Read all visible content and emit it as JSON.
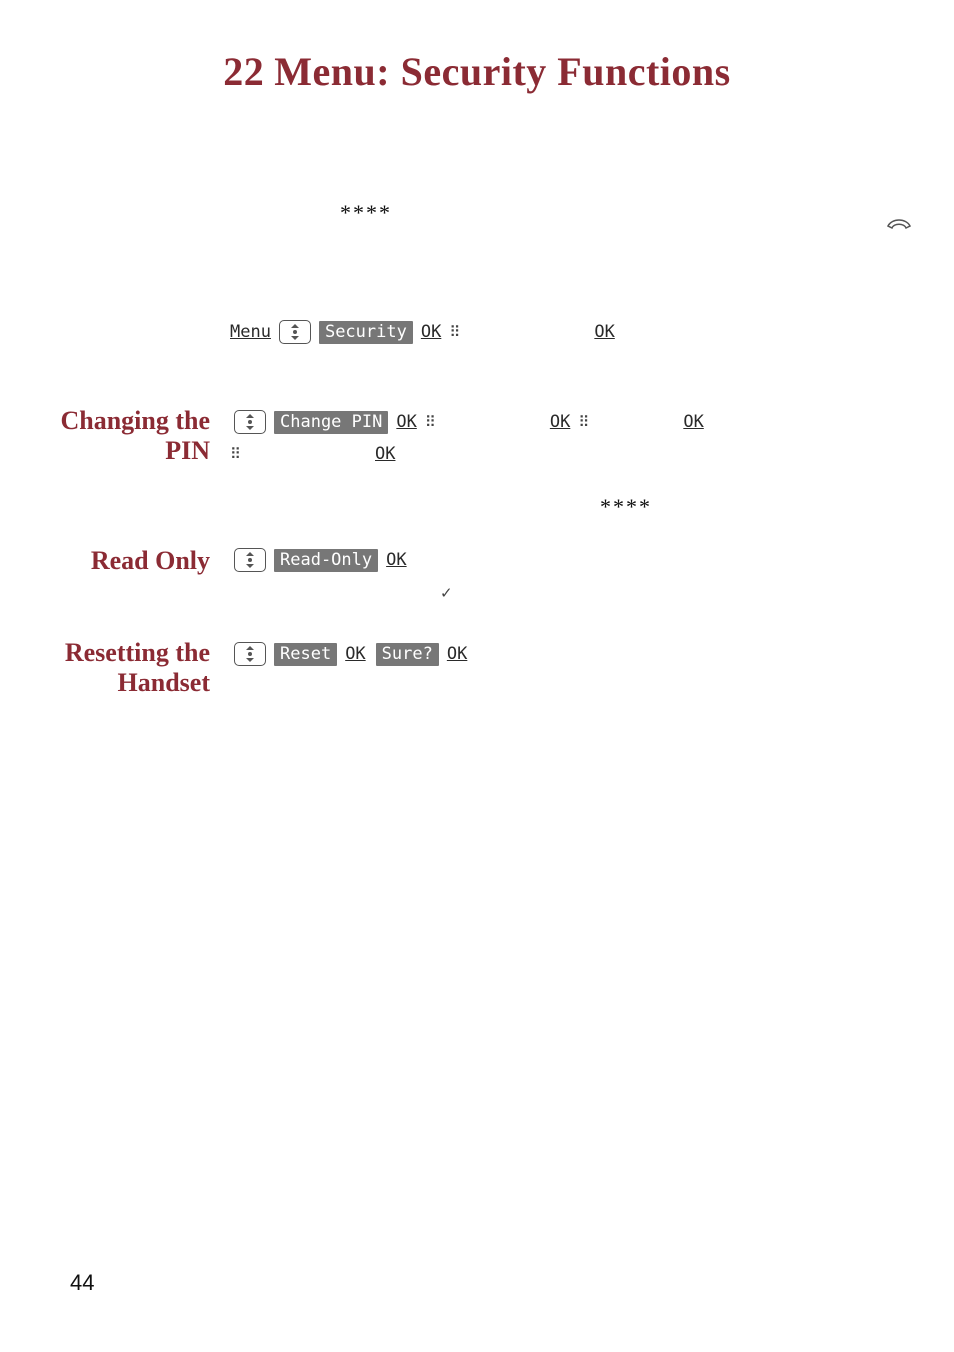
{
  "title": {
    "number": "22",
    "text": "Menu: Security Functions"
  },
  "intro": {
    "masked_pin": "****"
  },
  "phone_icon_name": "hangup-icon",
  "menu_path": {
    "menu_label": "Menu",
    "item": "Security",
    "ok1": "OK",
    "ok2": "OK"
  },
  "change_pin": {
    "heading_line1": "Changing the",
    "heading_line2": "PIN",
    "item": "Change PIN",
    "ok1": "OK",
    "ok2": "OK",
    "ok3": "OK",
    "ok4": "OK",
    "masked_new": "****"
  },
  "read_only": {
    "heading": "Read Only",
    "item": "Read-Only",
    "ok": "OK"
  },
  "reset": {
    "heading_line1": "Resetting the",
    "heading_line2": "Handset",
    "item": "Reset",
    "ok1": "OK",
    "confirm": "Sure?",
    "ok2": "OK"
  },
  "page_number": "44"
}
